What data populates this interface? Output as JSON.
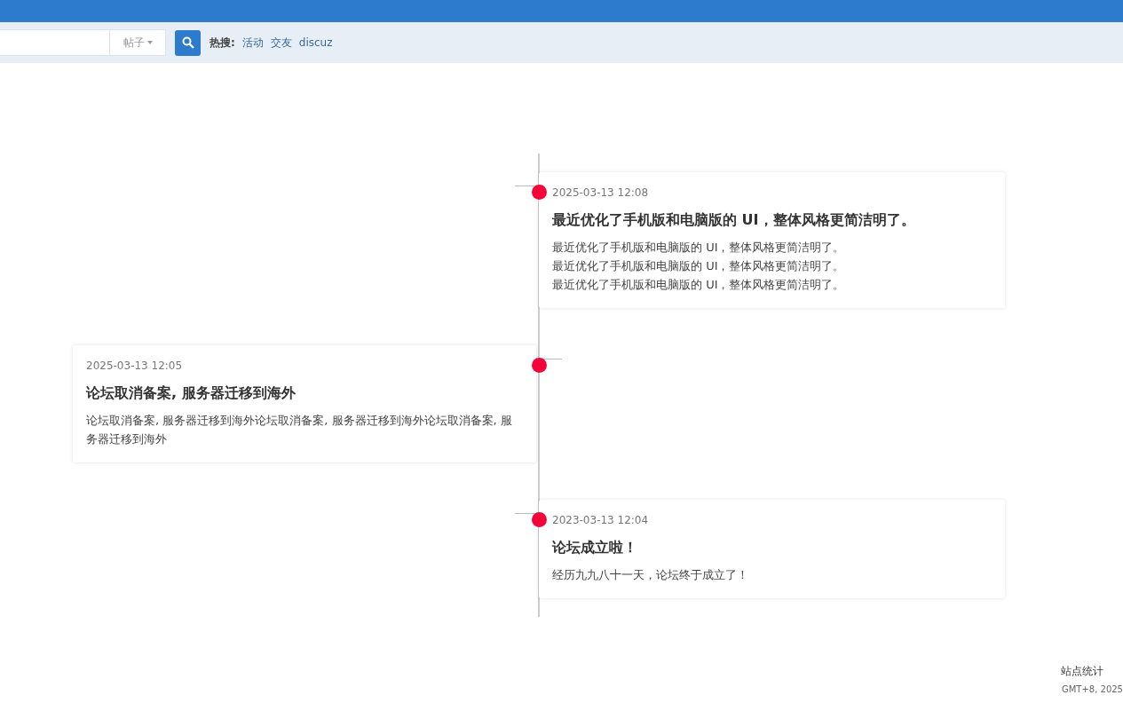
{
  "search": {
    "type_select": "帖子",
    "hot_label": "热搜:",
    "hot_links": [
      "活动",
      "交友",
      "discuz"
    ]
  },
  "timeline": [
    {
      "kind": "right",
      "time": "2025-03-13 12:08",
      "title": "最近优化了手机版和电脑版的 UI，整体风格更简洁明了。",
      "lines": [
        "最近优化了手机版和电脑版的 UI，整体风格更简洁明了。",
        "最近优化了手机版和电脑版的 UI，整体风格更简洁明了。",
        "最近优化了手机版和电脑版的 UI，整体风格更简洁明了。"
      ]
    },
    {
      "kind": "left",
      "time": "2025-03-13 12:05",
      "title": "论坛取消备案, 服务器迁移到海外",
      "lines": [
        "论坛取消备案, 服务器迁移到海外论坛取消备案, 服务器迁移到海外论坛取消备案, 服务器迁移到海外"
      ]
    },
    {
      "kind": "right",
      "time": "2023-03-13 12:04",
      "title": "论坛成立啦！",
      "lines": [
        "经历九九八十一天，论坛终于成立了！"
      ]
    }
  ],
  "footer": {
    "stats_link": "站点统计",
    "timezone": "GMT+8, 2025"
  }
}
